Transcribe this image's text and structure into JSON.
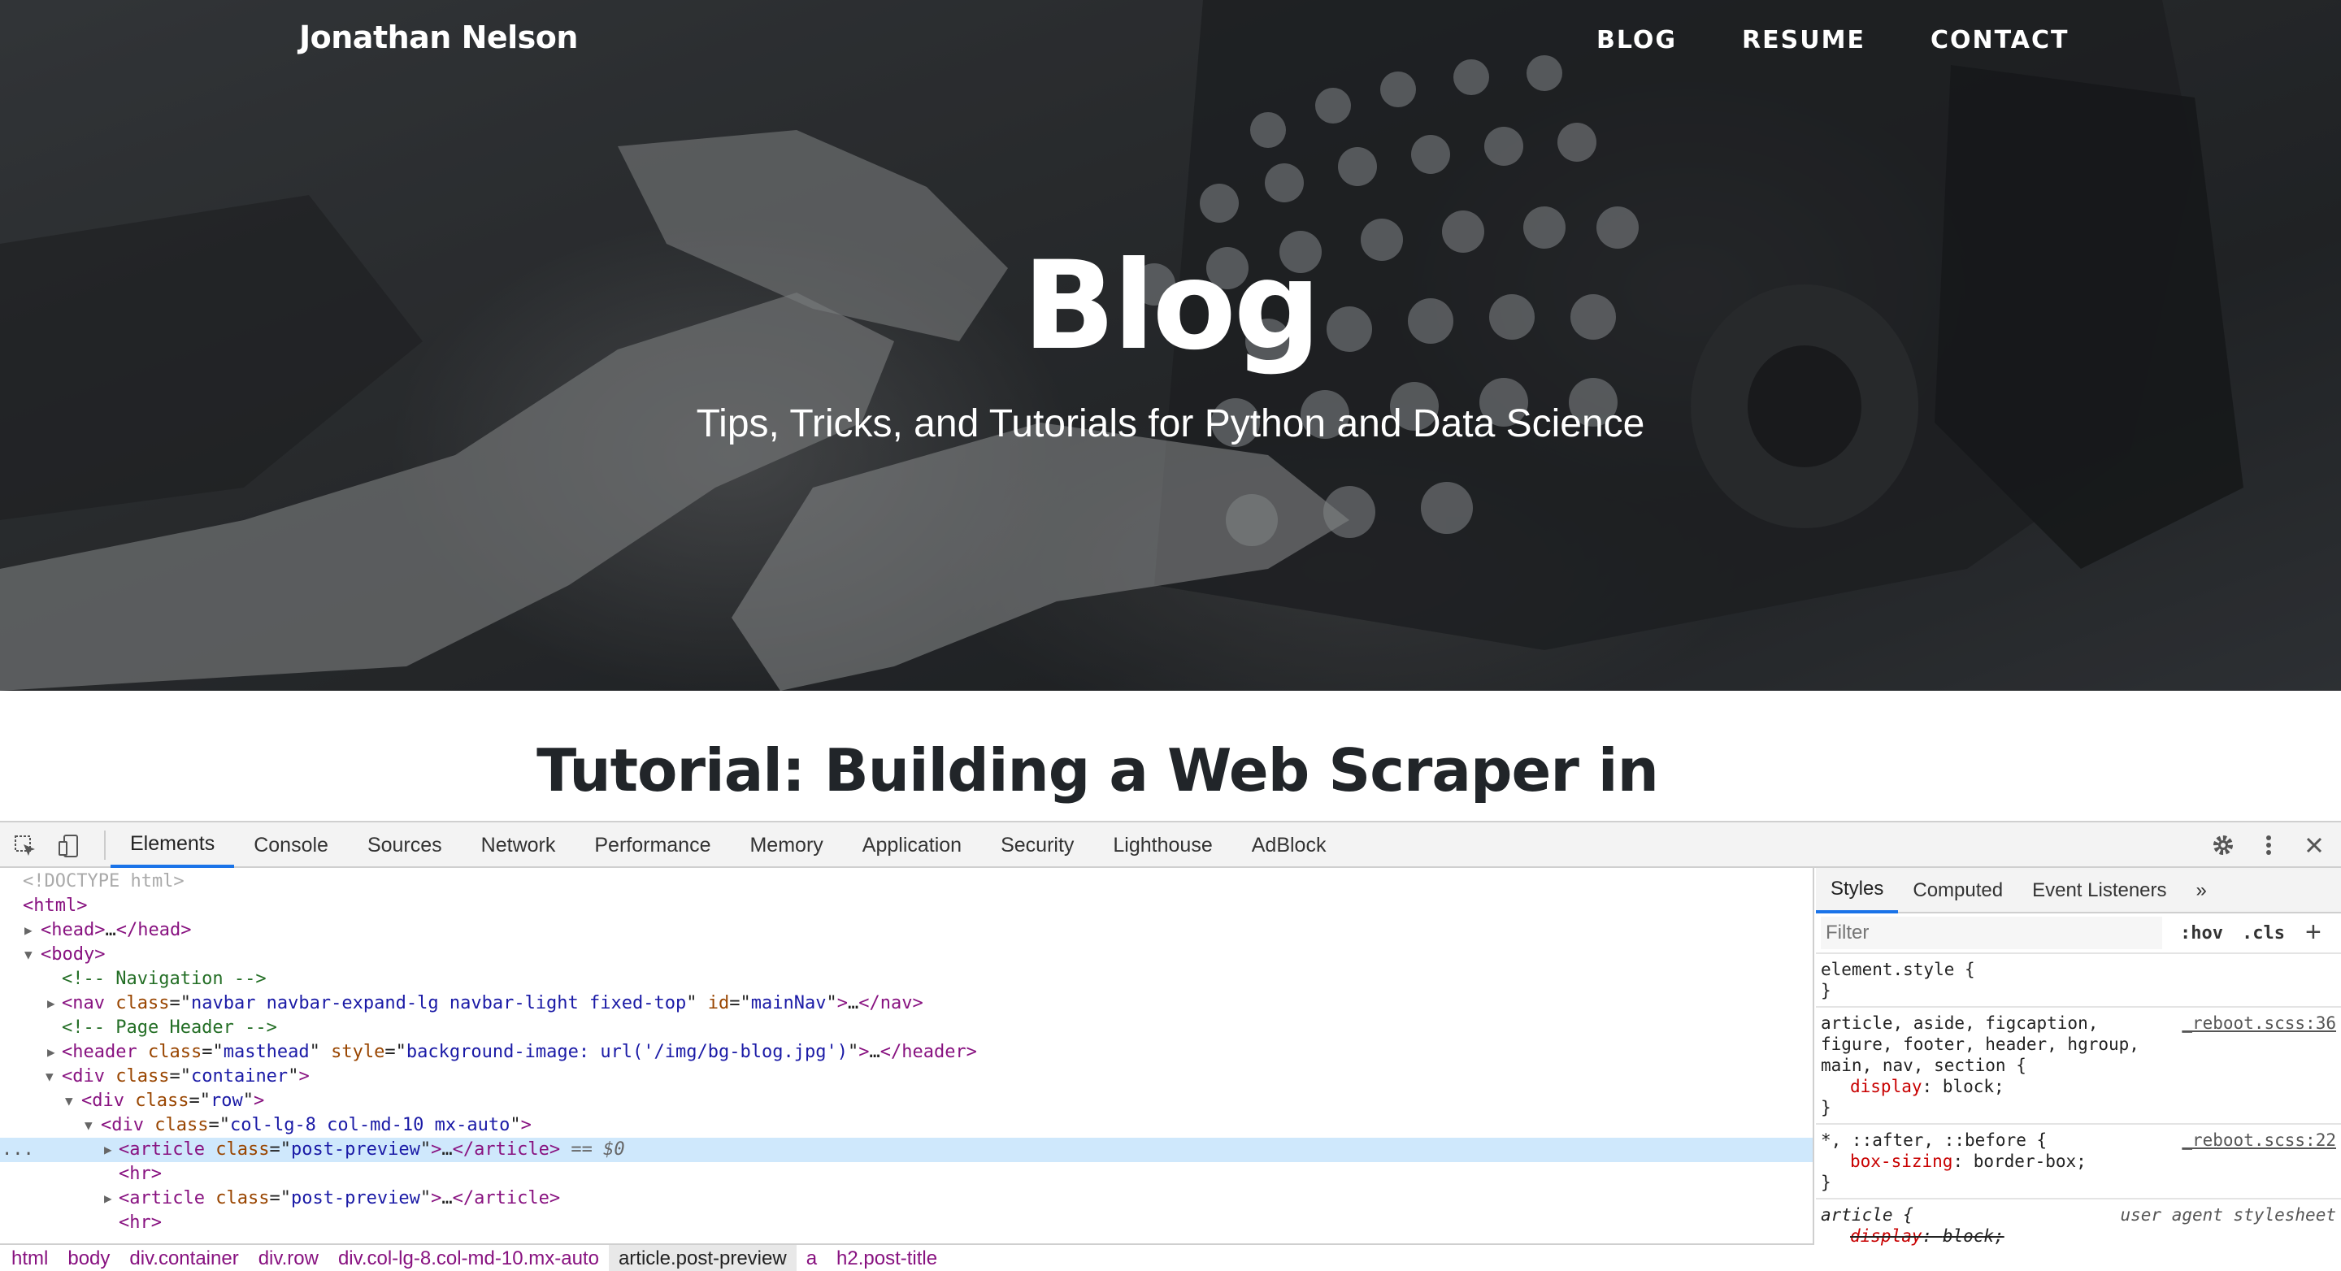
{
  "site": {
    "brand": "Jonathan Nelson",
    "nav": [
      "BLOG",
      "RESUME",
      "CONTACT"
    ],
    "hero_title": "Blog",
    "hero_subtitle": "Tips, Tricks, and Tutorials for Python and Data Science",
    "post_title": "Tutorial: Building a Web Scraper in"
  },
  "devtools": {
    "tabs": [
      "Elements",
      "Console",
      "Sources",
      "Network",
      "Performance",
      "Memory",
      "Application",
      "Security",
      "Lighthouse",
      "AdBlock"
    ],
    "active_tab": "Elements",
    "dom": {
      "doctype": "<!DOCTYPE html>",
      "html_open": "<html>",
      "head": "head",
      "body": "body",
      "comment_nav": "<!-- Navigation -->",
      "nav_attrs": {
        "class": "navbar navbar-expand-lg navbar-light fixed-top",
        "id": "mainNav"
      },
      "comment_header": "<!-- Page Header -->",
      "header_attrs": {
        "class": "masthead",
        "style": "background-image: url('/img/bg-blog.jpg')"
      },
      "div_container_class": "container",
      "div_row_class": "row",
      "div_col_class": "col-lg-8 col-md-10 mx-auto",
      "article_class": "post-preview",
      "selected_marker": "== $0",
      "gutter_dots": "..."
    },
    "breadcrumbs": [
      "html",
      "body",
      "div.container",
      "div.row",
      "div.col-lg-8.col-md-10.mx-auto",
      "article.post-preview",
      "a",
      "h2.post-title"
    ],
    "current_breadcrumb": "article.post-preview",
    "styles": {
      "tabs": [
        "Styles",
        "Computed",
        "Event Listeners"
      ],
      "more": "»",
      "filter_placeholder": "Filter",
      "hov": ":hov",
      "cls": ".cls",
      "plus": "+",
      "element_style": "element.style {",
      "rule1_selector": "article, aside, figcaption, figure, footer, header, hgroup, main, nav, section {",
      "rule1_source": "_reboot.scss:36",
      "rule1_prop": "display",
      "rule1_value": "block;",
      "rule2_selector": "*, ::after, ::before {",
      "rule2_source": "_reboot.scss:22",
      "rule2_prop": "box-sizing",
      "rule2_value": "border-box;",
      "rule3_selector": "article {",
      "rule3_source": "user agent stylesheet",
      "rule3_prop": "display",
      "rule3_value": "block;",
      "close_brace": "}"
    }
  }
}
